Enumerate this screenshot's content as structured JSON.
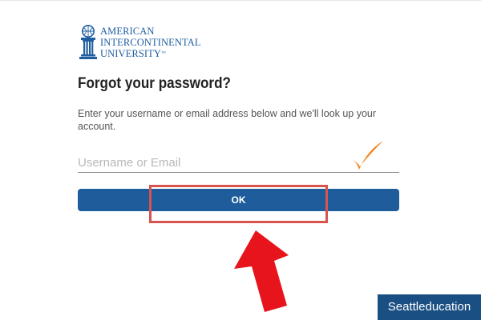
{
  "logo": {
    "line1": "AMERICAN",
    "line2": "INTERCONTINENTAL",
    "line3": "UNIVERSITY",
    "trademark": "™",
    "brand_color": "#1f5ea0"
  },
  "form": {
    "title": "Forgot your password?",
    "description": "Enter your username or email address below and we'll look up your account.",
    "username_placeholder": "Username or Email",
    "username_value": "",
    "submit_label": "OK",
    "button_color": "#1f5c9b"
  },
  "annotations": {
    "checkmark_icon": "checkmark-icon",
    "checkmark_color": "#f0861e",
    "highlight_color": "#d9534f",
    "arrow_icon": "arrow-up-icon",
    "arrow_color": "#e8141b"
  },
  "watermark": {
    "text": "Seattleducation",
    "background": "#1a4f83"
  }
}
